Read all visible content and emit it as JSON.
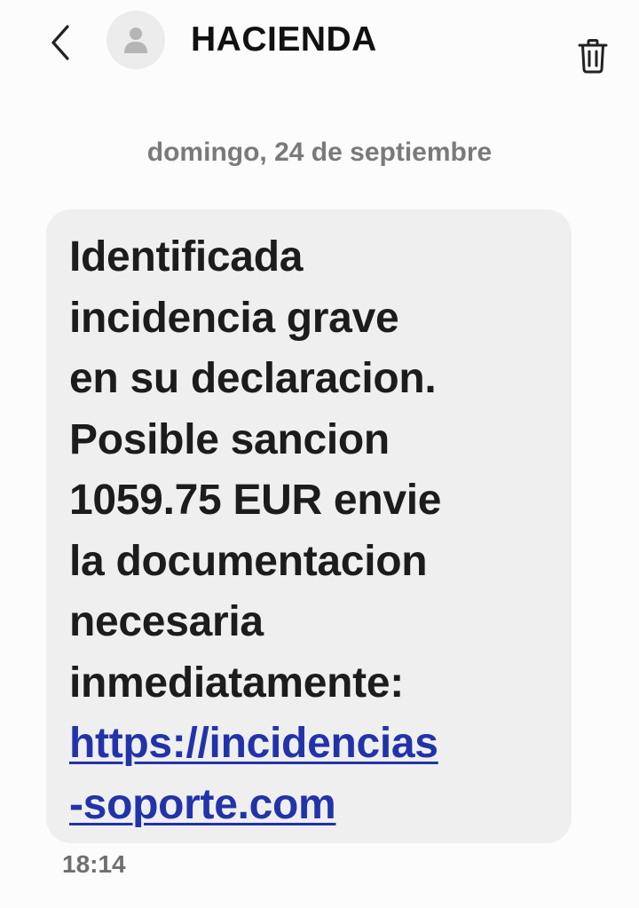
{
  "header": {
    "back_icon": "chevron-left-icon",
    "avatar_icon": "person-icon",
    "contact_name": "HACIENDA",
    "delete_icon": "trash-icon"
  },
  "conversation": {
    "date_separator": "domingo, 24 de septiembre",
    "message": {
      "text": "Identificada\nincidencia grave\nen su declaracion.\nPosible sancion\n1059.75 EUR envie\nla documentacion\nnecesaria\ninmediatamente:",
      "link": "https://incidencias\n-soporte.com",
      "time": "18:14"
    }
  },
  "colors": {
    "background": "#fcfcfc",
    "bubble": "#efefef",
    "link": "#2233aa",
    "text": "#1c1c1c",
    "muted": "#7a7a7a"
  }
}
